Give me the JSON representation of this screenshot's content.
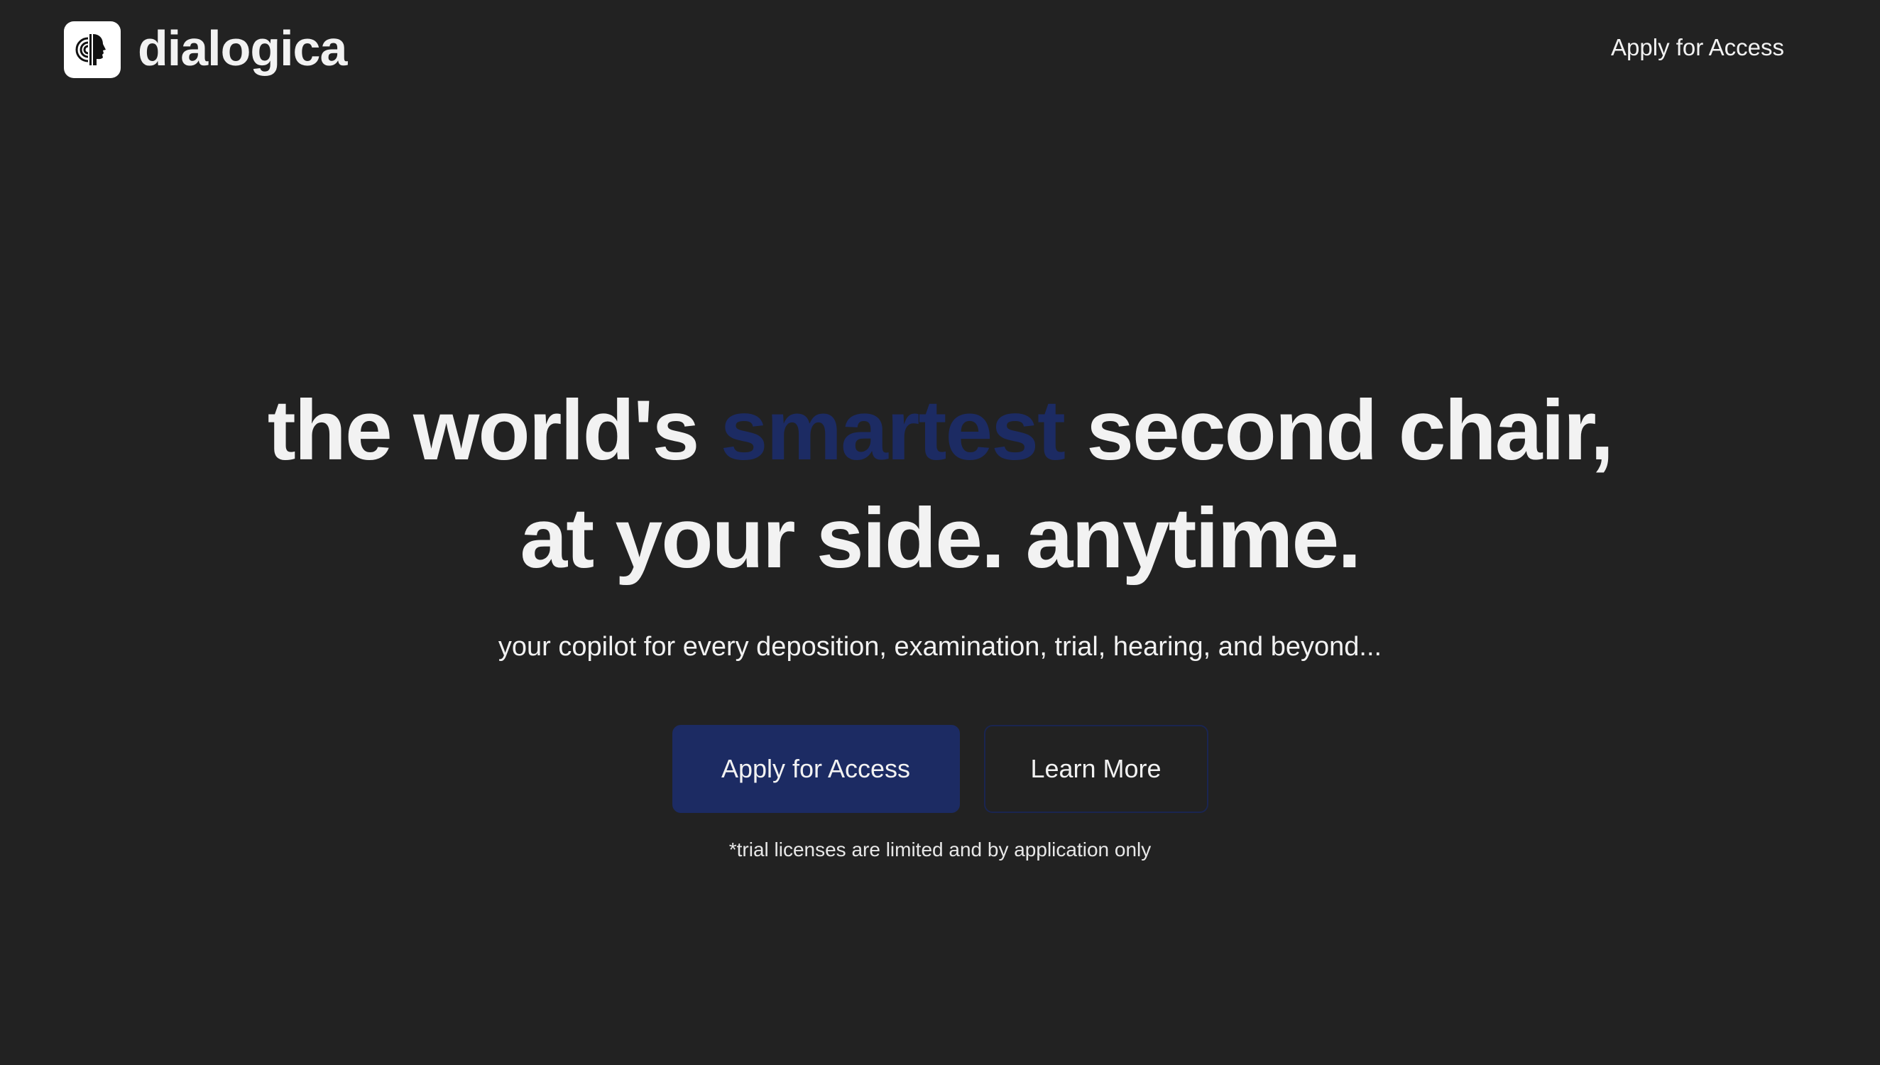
{
  "header": {
    "brand_name": "dialogica",
    "logo_icon": "face-profile-logo-icon",
    "nav_apply_label": "Apply for Access"
  },
  "hero": {
    "headline_part1": "the world's ",
    "headline_accent": "smartest",
    "headline_part2": " second chair,",
    "headline_line2": "at your side. anytime.",
    "subtitle": "your copilot for every deposition, examination, trial, hearing, and beyond...",
    "primary_button_label": "Apply for Access",
    "secondary_button_label": "Learn More",
    "footnote": "*trial licenses are limited and by application only"
  },
  "colors": {
    "background": "#222222",
    "text": "#f2f2f2",
    "accent": "#1c2b63"
  }
}
